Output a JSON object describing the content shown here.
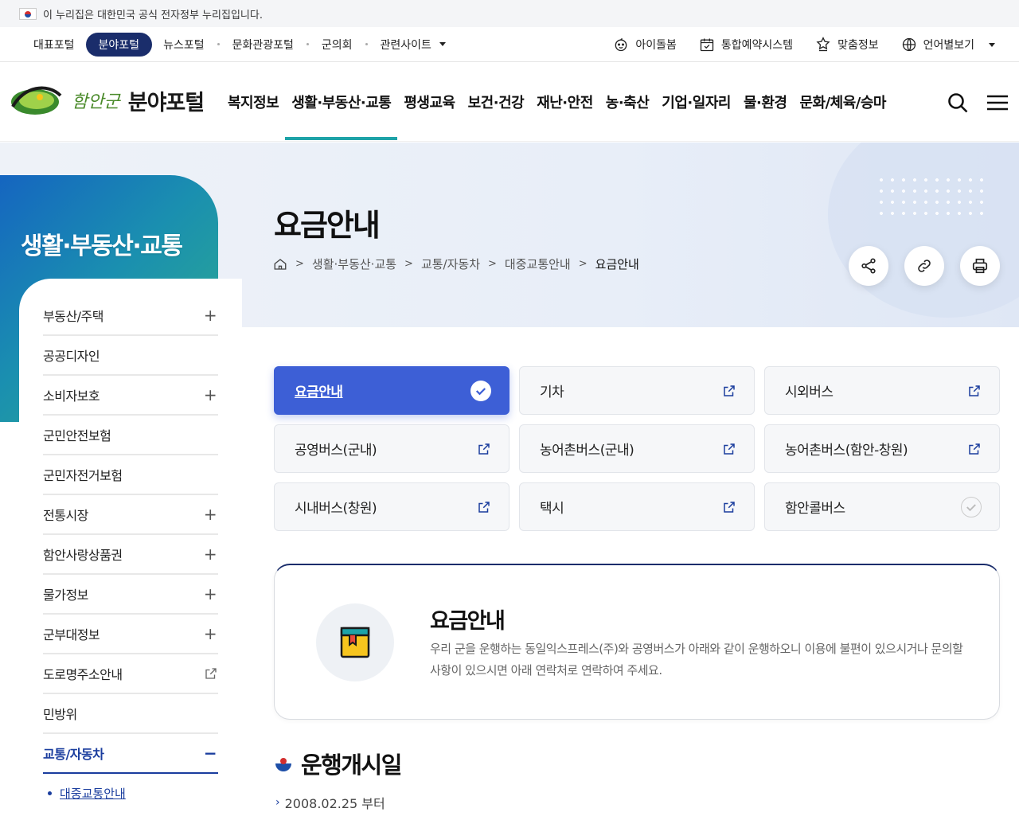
{
  "gov_banner": {
    "text": "이 누리집은 대한민국 공식 전자정부 누리집입니다."
  },
  "util_nav": {
    "left": [
      {
        "label": "대표포털",
        "active": false
      },
      {
        "label": "분야포털",
        "active": true
      },
      {
        "label": "뉴스포털",
        "active": false
      },
      {
        "label": "문화관광포털",
        "active": false
      },
      {
        "label": "군의회",
        "active": false
      },
      {
        "label": "관련사이트",
        "active": false
      }
    ],
    "right": [
      {
        "label": "아이돌봄",
        "icon": "baby-face-icon"
      },
      {
        "label": "통합예약시스템",
        "icon": "calendar-check-icon"
      },
      {
        "label": "맞춤정보",
        "icon": "star-hand-icon"
      },
      {
        "label": "언어별보기",
        "icon": "globe-icon"
      }
    ]
  },
  "header": {
    "logo_script": "함안군",
    "logo_title": "분야포털",
    "gnb": [
      {
        "label": "복지정보",
        "active": false
      },
      {
        "label": "생활·부동산·교통",
        "active": true
      },
      {
        "label": "평생교육",
        "active": false
      },
      {
        "label": "보건·건강",
        "active": false
      },
      {
        "label": "재난·안전",
        "active": false
      },
      {
        "label": "농·축산",
        "active": false
      },
      {
        "label": "기업·일자리",
        "active": false
      },
      {
        "label": "물·환경",
        "active": false
      },
      {
        "label": "문화/체육/승마",
        "active": false
      }
    ]
  },
  "side": {
    "title": "생활·부동산·교통",
    "items": [
      {
        "label": "부동산/주택",
        "mark": "+"
      },
      {
        "label": "공공디자인",
        "mark": ""
      },
      {
        "label": "소비자보호",
        "mark": "+"
      },
      {
        "label": "군민안전보험",
        "mark": ""
      },
      {
        "label": "군민자전거보험",
        "mark": ""
      },
      {
        "label": "전통시장",
        "mark": "+"
      },
      {
        "label": "함안사랑상품권",
        "mark": "+"
      },
      {
        "label": "물가정보",
        "mark": "+"
      },
      {
        "label": "군부대정보",
        "mark": "+"
      },
      {
        "label": "도로명주소안내",
        "mark": "ext"
      },
      {
        "label": "민방위",
        "mark": ""
      },
      {
        "label": "교통/자동차",
        "mark": "−",
        "active": true
      }
    ],
    "sub_item": "대중교통안내"
  },
  "content": {
    "title": "요금안내",
    "breadcrumb": [
      "생활·부동산·교통",
      "교통/자동차",
      "대중교통안내",
      "요금안내"
    ],
    "tabs": [
      {
        "label": "요금안내",
        "type": "active"
      },
      {
        "label": "기차",
        "type": "external"
      },
      {
        "label": "시외버스",
        "type": "external"
      },
      {
        "label": "공영버스(군내)",
        "type": "external"
      },
      {
        "label": "농어촌버스(군내)",
        "type": "external"
      },
      {
        "label": "농어촌버스(함안-창원)",
        "type": "external"
      },
      {
        "label": "시내버스(창원)",
        "type": "external"
      },
      {
        "label": "택시",
        "type": "external"
      },
      {
        "label": "함안콜버스",
        "type": "check"
      }
    ],
    "info": {
      "heading": "요금안내",
      "body": "우리 군을 운행하는 동일익스프레스(주)와 공영버스가 아래와 같이 운행하오니 이용에 불편이 있으시거나 문의할 사항이 있으시면 아래 연락처로 연락하여 주세요."
    },
    "section_title": "운행개시일",
    "section_item": "2008.02.25 부터"
  },
  "colors": {
    "brand_navy": "#1a2d6b",
    "active_tab": "#3d5fd6",
    "gnb_underline": "#1ea3a8"
  }
}
